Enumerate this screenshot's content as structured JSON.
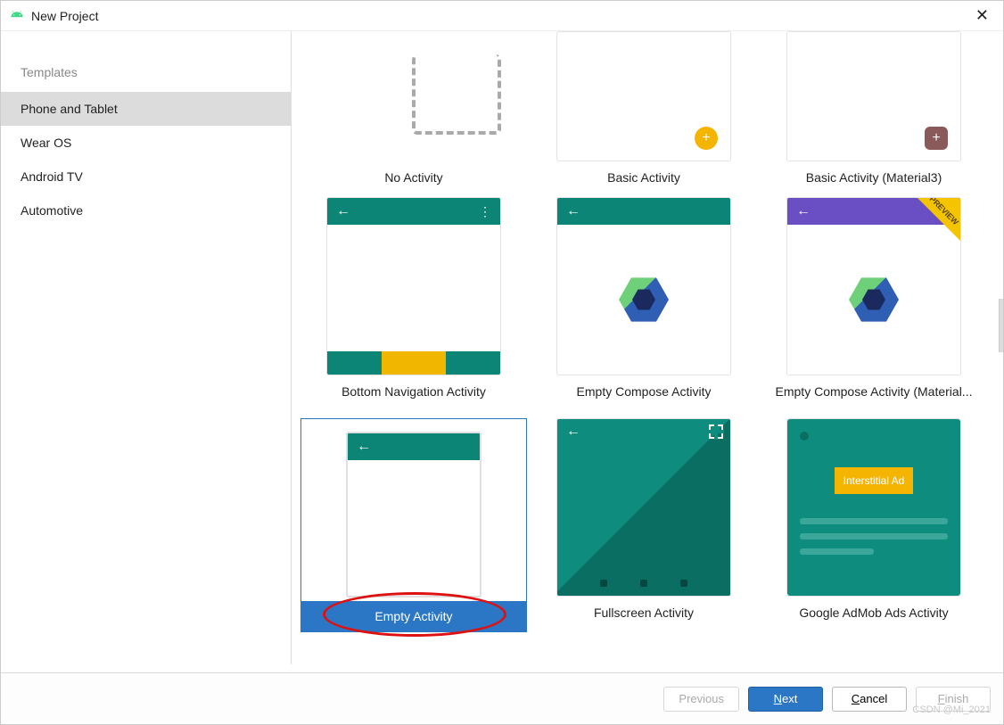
{
  "window": {
    "title": "New Project"
  },
  "sidebar": {
    "heading": "Templates",
    "items": [
      {
        "label": "Phone and Tablet"
      },
      {
        "label": "Wear OS"
      },
      {
        "label": "Android TV"
      },
      {
        "label": "Automotive"
      }
    ],
    "selected": "Phone and Tablet"
  },
  "templates": {
    "row0": [
      {
        "label": "No Activity"
      },
      {
        "label": "Basic Activity"
      },
      {
        "label": "Basic Activity (Material3)"
      }
    ],
    "row1": [
      {
        "label": "Bottom Navigation Activity"
      },
      {
        "label": "Empty Compose Activity"
      },
      {
        "label": "Empty Compose Activity (Material..."
      }
    ],
    "row2": [
      {
        "label": "Empty Activity",
        "selected": true
      },
      {
        "label": "Fullscreen Activity"
      },
      {
        "label": "Google AdMob Ads Activity"
      }
    ]
  },
  "preview_ribbon": "PREVIEW",
  "admob_button": "Interstitial Ad",
  "footer": {
    "previous": "Previous",
    "next": "Next",
    "next_hotkey": "N",
    "cancel": "Cancel",
    "cancel_hotkey": "C",
    "finish": "Finish",
    "finish_hotkey": "F"
  },
  "watermark": "CSDN @Mi_2021"
}
